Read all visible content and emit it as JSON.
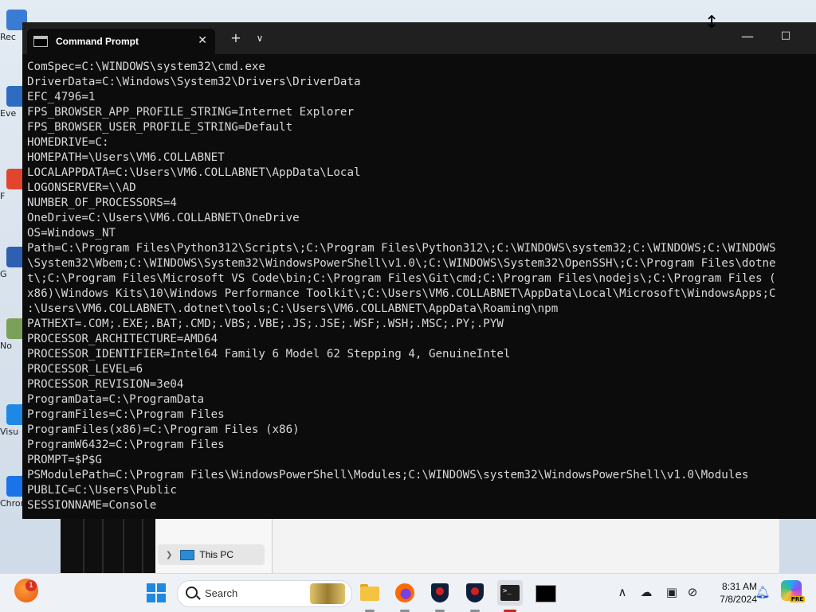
{
  "desktop": {
    "icons": [
      {
        "label": "Rec",
        "name": "recycle-bin-icon",
        "color": "#3a7bd5"
      },
      {
        "label": "Eve",
        "name": "event-viewer-icon",
        "color": "#2d6cc0"
      },
      {
        "label": "F",
        "name": "app-shortcut-icon",
        "color": "#e2452e"
      },
      {
        "label": "G",
        "name": "app-shortcut-icon",
        "color": "#2f5fb0"
      },
      {
        "label": "No",
        "name": "notepad-icon",
        "color": "#7aa05a"
      },
      {
        "label": "Visu",
        "name": "visual-studio-icon",
        "color": "#1e88e5"
      },
      {
        "label": "Chrom",
        "name": "chrome-icon",
        "color": "#1a73e8"
      }
    ]
  },
  "explorer": {
    "nav_item": "This PC"
  },
  "terminal": {
    "tab_title": "Command Prompt",
    "lines": [
      "ComSpec=C:\\WINDOWS\\system32\\cmd.exe",
      "DriverData=C:\\Windows\\System32\\Drivers\\DriverData",
      "EFC_4796=1",
      "FPS_BROWSER_APP_PROFILE_STRING=Internet Explorer",
      "FPS_BROWSER_USER_PROFILE_STRING=Default",
      "HOMEDRIVE=C:",
      "HOMEPATH=\\Users\\VM6.COLLABNET",
      "LOCALAPPDATA=C:\\Users\\VM6.COLLABNET\\AppData\\Local",
      "LOGONSERVER=\\\\AD",
      "NUMBER_OF_PROCESSORS=4",
      "OneDrive=C:\\Users\\VM6.COLLABNET\\OneDrive",
      "OS=Windows_NT",
      "Path=C:\\Program Files\\Python312\\Scripts\\;C:\\Program Files\\Python312\\;C:\\WINDOWS\\system32;C:\\WINDOWS;C:\\WINDOWS",
      "\\System32\\Wbem;C:\\WINDOWS\\System32\\WindowsPowerShell\\v1.0\\;C:\\WINDOWS\\System32\\OpenSSH\\;C:\\Program Files\\dotne",
      "t\\;C:\\Program Files\\Microsoft VS Code\\bin;C:\\Program Files\\Git\\cmd;C:\\Program Files\\nodejs\\;C:\\Program Files (",
      "x86)\\Windows Kits\\10\\Windows Performance Toolkit\\;C:\\Users\\VM6.COLLABNET\\AppData\\Local\\Microsoft\\WindowsApps;C",
      ":\\Users\\VM6.COLLABNET\\.dotnet\\tools;C:\\Users\\VM6.COLLABNET\\AppData\\Roaming\\npm",
      "PATHEXT=.COM;.EXE;.BAT;.CMD;.VBS;.VBE;.JS;.JSE;.WSF;.WSH;.MSC;.PY;.PYW",
      "PROCESSOR_ARCHITECTURE=AMD64",
      "PROCESSOR_IDENTIFIER=Intel64 Family 6 Model 62 Stepping 4, GenuineIntel",
      "PROCESSOR_LEVEL=6",
      "PROCESSOR_REVISION=3e04",
      "ProgramData=C:\\ProgramData",
      "ProgramFiles=C:\\Program Files",
      "ProgramFiles(x86)=C:\\Program Files (x86)",
      "ProgramW6432=C:\\Program Files",
      "PROMPT=$P$G",
      "PSModulePath=C:\\Program Files\\WindowsPowerShell\\Modules;C:\\WINDOWS\\system32\\WindowsPowerShell\\v1.0\\Modules",
      "PUBLIC=C:\\Users\\Public",
      "SESSIONNAME=Console"
    ]
  },
  "taskbar": {
    "weather_badge": "1",
    "search_placeholder": "Search",
    "clock_time": "8:31 AM",
    "clock_date": "7/8/2024",
    "copilot_badge": "PRE"
  }
}
